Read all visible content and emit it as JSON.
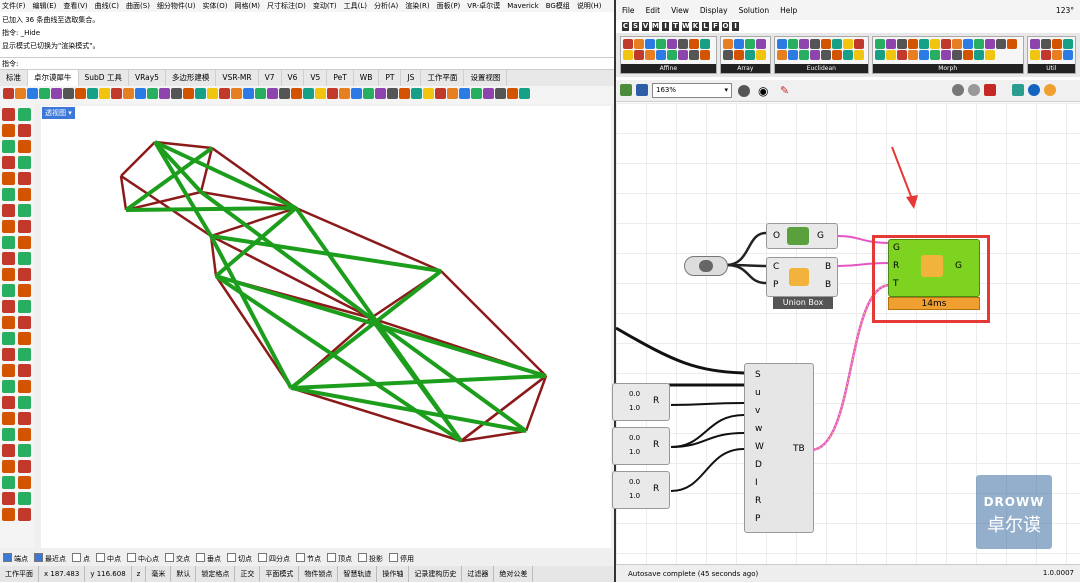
{
  "rhino": {
    "menu": [
      "文件(F)",
      "编辑(E)",
      "查看(V)",
      "曲线(C)",
      "曲面(S)",
      "细分物件(U)",
      "实体(O)",
      "网格(M)",
      "尺寸标注(D)",
      "变动(T)",
      "工具(L)",
      "分析(A)",
      "渲染(R)",
      "面板(P)",
      "VR-卓尔谟",
      "Maverick",
      "BG模组",
      "说明(H)"
    ],
    "command_history": [
      "已加入 36 条曲线至选取集合。",
      "指令: _Hide",
      "显示模式已切换为\"渲染模式\"。"
    ],
    "prompt": "指令:",
    "tabs": [
      "标准",
      "卓尔谟犀牛",
      "SubD 工具",
      "VRay5",
      "多边形建模",
      "VSR-MR",
      "V7",
      "V6",
      "V5",
      "PeT",
      "WB",
      "PT",
      "JS",
      "工作平面",
      "设置视图"
    ],
    "active_tab_index": 1,
    "viewport_label": "透视图",
    "snaps": [
      {
        "label": "端点",
        "on": true
      },
      {
        "label": "最近点",
        "on": true
      },
      {
        "label": "点",
        "on": false
      },
      {
        "label": "中点",
        "on": false
      },
      {
        "label": "中心点",
        "on": false
      },
      {
        "label": "交点",
        "on": false
      },
      {
        "label": "垂点",
        "on": false
      },
      {
        "label": "切点",
        "on": false
      },
      {
        "label": "四分点",
        "on": false
      },
      {
        "label": "节点",
        "on": false
      },
      {
        "label": "顶点",
        "on": false
      },
      {
        "label": "投影",
        "on": false
      },
      {
        "label": "停用",
        "on": false
      }
    ],
    "status": [
      "工作平面",
      "x 187.483",
      "y 116.608",
      "z",
      "毫米",
      "默认",
      "锁定格点",
      "正交",
      "平面模式",
      "物件锁点",
      "智慧轨迹",
      "操作轴",
      "记录建构历史",
      "过滤器",
      "绝对公差"
    ],
    "colors": {
      "red": "#8b1a1a",
      "green": "#1c9e1c"
    }
  },
  "gh": {
    "menu": [
      "File",
      "Edit",
      "View",
      "Display",
      "Solution",
      "Help"
    ],
    "counter": "123°",
    "tabrow": [
      "C",
      "S",
      "V",
      "M",
      "I",
      "T",
      "W",
      "K",
      "L",
      "F",
      "O",
      "I"
    ],
    "panels": [
      "Affine",
      "Array",
      "Euclidean",
      "Morph",
      "Util"
    ],
    "zoom": "163%",
    "components": {
      "top": {
        "in": "O",
        "out": "G"
      },
      "union_box": {
        "label": "Union Box",
        "in": [
          "C",
          "P"
        ],
        "out": [
          "B",
          "B"
        ]
      },
      "selected": {
        "in": [
          "G",
          "R",
          "T"
        ],
        "out": "G",
        "time": "14ms"
      },
      "tb": {
        "in": [
          "S",
          "u",
          "v",
          "w",
          "W",
          "D",
          "I",
          "R",
          "P"
        ],
        "out": "TB"
      },
      "sliders": [
        {
          "value": "0.0",
          "value2": "1.0",
          "out": "R"
        },
        {
          "value": "0.0",
          "value2": "1.0",
          "out": "R"
        },
        {
          "value": "0.0",
          "value2": "1.0",
          "out": "R"
        }
      ]
    },
    "status": "Autosave complete (45 seconds ago)",
    "version": "1.0.0007",
    "watermark": {
      "brand": "DROWW",
      "name": "卓尔谟"
    },
    "colors": {
      "highlight": "#e53935",
      "selected": "#7ed321",
      "pink": "#e455c6"
    }
  }
}
